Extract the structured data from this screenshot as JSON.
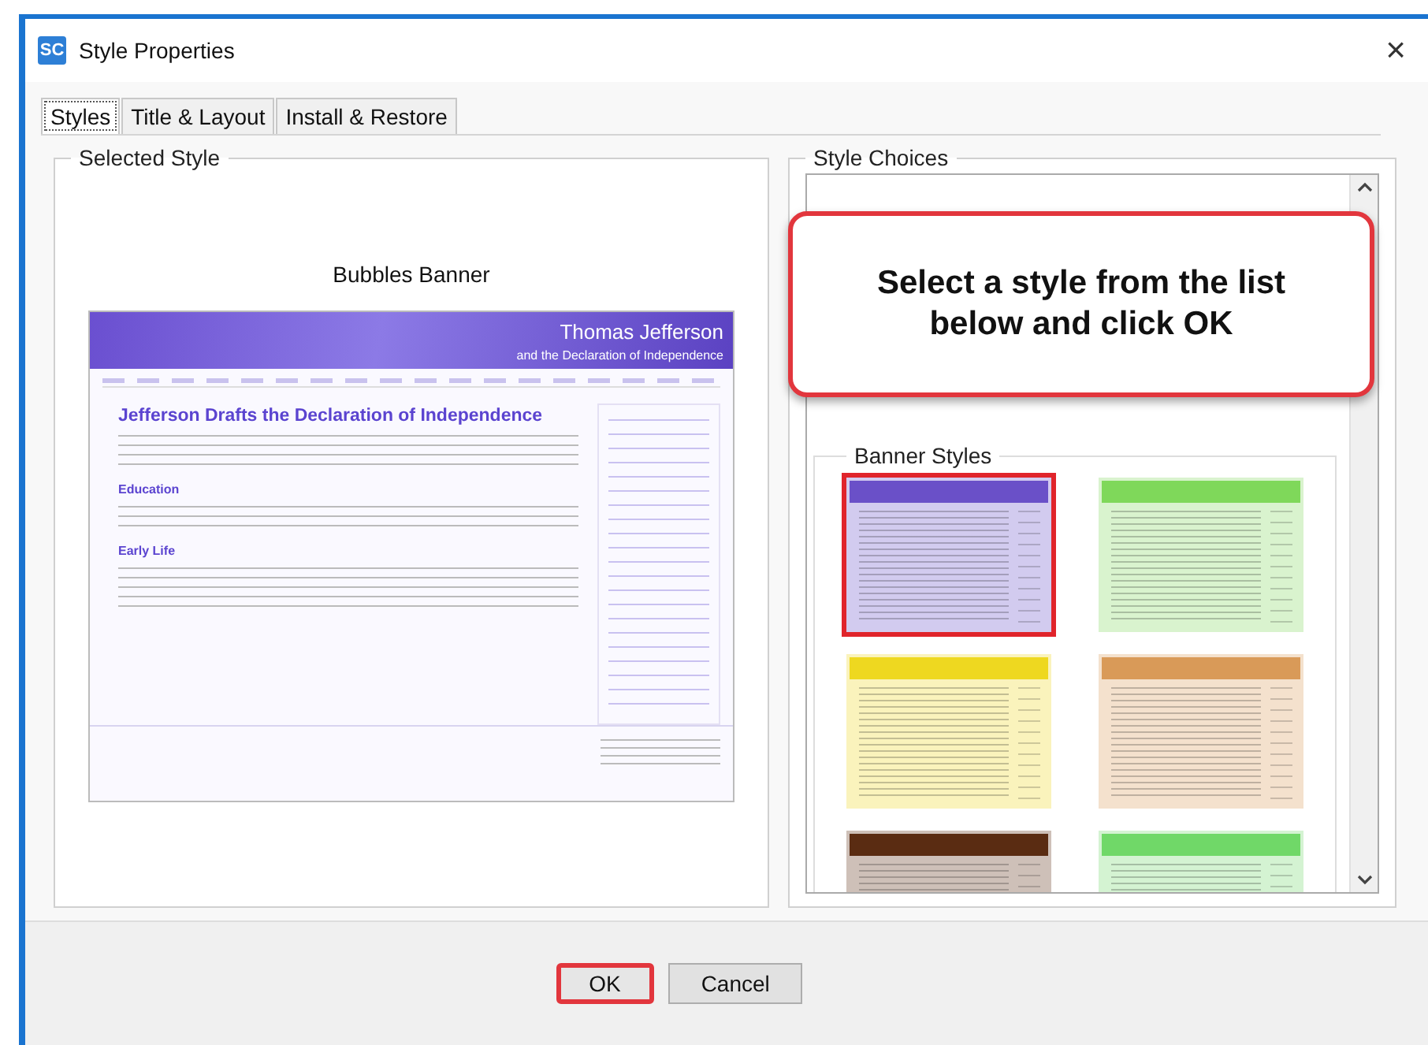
{
  "window": {
    "icon_label": "SC",
    "title": "Style Properties",
    "close": "×"
  },
  "tabs": [
    {
      "label": "Styles",
      "selected": true
    },
    {
      "label": "Title & Layout",
      "selected": false
    },
    {
      "label": "Install & Restore",
      "selected": false
    }
  ],
  "selected_style": {
    "legend": "Selected Style",
    "name": "Bubbles Banner",
    "preview": {
      "banner_title": "Thomas Jefferson",
      "banner_subtitle": "and the Declaration of Independence",
      "headline": "Jefferson Drafts the Declaration of Independence",
      "sections": [
        "Education",
        "Early Life"
      ]
    }
  },
  "style_choices": {
    "legend": "Style Choices",
    "callout": "Select a style from the list below and click OK",
    "group_legend": "Banner Styles",
    "styles": [
      {
        "color": "#6a50c8",
        "selected": true
      },
      {
        "color": "#7fd85a",
        "selected": false
      },
      {
        "color": "#eed820",
        "selected": false
      },
      {
        "color": "#d99a58",
        "selected": false
      },
      {
        "color": "#5a2c12",
        "selected": false
      },
      {
        "color": "#70d868",
        "selected": false
      }
    ]
  },
  "buttons": [
    {
      "label": "OK",
      "highlighted": true
    },
    {
      "label": "Cancel",
      "highlighted": false
    }
  ]
}
